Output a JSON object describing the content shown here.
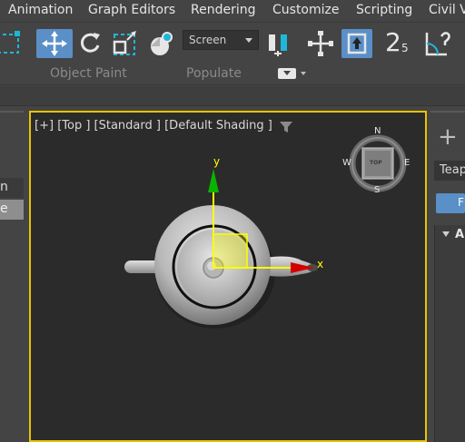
{
  "menu": {
    "items": [
      "Animation",
      "Graph Editors",
      "Rendering",
      "Customize",
      "Scripting",
      "Civil Vi"
    ]
  },
  "toolbar": {
    "reference_coord_value": "Screen",
    "snap_label": "2",
    "snap_sub": "5",
    "icons": [
      "select-region-icon",
      "move-icon",
      "rotate-icon",
      "scale-region-icon",
      "selection-filter-icon",
      "use-pivot-icon",
      "select-manipulate-icon",
      "keyboard-shortcut-icon",
      "snap-toggle-icon",
      "angle-snap-icon"
    ]
  },
  "ribbon": {
    "tab_object_paint": "Object Paint",
    "tab_populate": "Populate"
  },
  "left_panel": {
    "row1": "n",
    "row2": "e"
  },
  "viewport": {
    "label_plus": "[+]",
    "label_view": "[Top ]",
    "label_mode": "[Standard ]",
    "label_shading": "[Default Shading ]",
    "axis_y": "y",
    "axis_x": "x",
    "compass_n": "N",
    "compass_s": "S",
    "compass_e": "E",
    "compass_w": "W",
    "viewcube_face": "TOP",
    "object": "Teapot"
  },
  "command_panel": {
    "create_plus": "+",
    "object_name": "Teap",
    "button_label": "F",
    "rollout_label": "A"
  },
  "colors": {
    "background": "#444444",
    "viewport_bg": "#2b2b2b",
    "viewport_border": "#e8c300",
    "active_blue": "#5a8fc7",
    "axis_y_green": "#0bb300",
    "axis_x_red": "#d40000",
    "gizmo_yellow": "#ffff00"
  }
}
